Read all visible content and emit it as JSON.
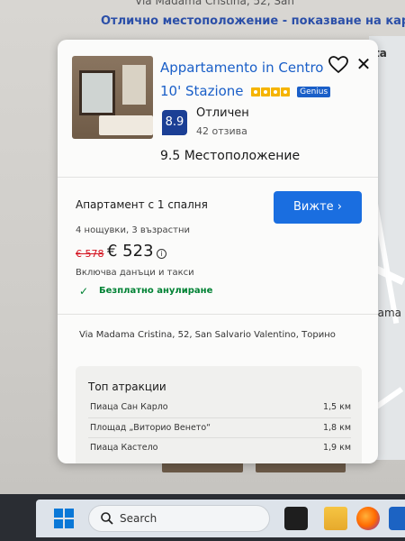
{
  "background": {
    "address_snippet": "Via Madama Cristina, 52, San",
    "map_link": "Отлично местоположение - показване на карта",
    "map_label": "dama",
    "map_badge": "ta"
  },
  "card": {
    "title_line1": "Appartamento in Centro",
    "title_line2": "10' Stazione",
    "stars": 4,
    "genius_badge": "Genius",
    "rating": {
      "score": "8.9",
      "label": "Отличен",
      "reviews": "42 отзива"
    },
    "location_score": "9.5 Местоположение",
    "room": {
      "name": "Апартамент с 1 спалня",
      "see_button": "Вижте",
      "nights": "4 нощувки, 3 възрастни",
      "price_old": "€ 578",
      "price_new": "€ 523",
      "taxes": "Включва данъци и такси",
      "free_cancel": "Безплатно анулиране"
    },
    "address": "Via Madama Cristina, 52, San Salvario Valentino, Торино",
    "attractions": {
      "title": "Топ атракции",
      "items": [
        {
          "name": "Пиаца Сан Карло",
          "distance": "1,5 км"
        },
        {
          "name": "Площад „Виторио Венето“",
          "distance": "1,8 км"
        },
        {
          "name": "Пиаца Кастело",
          "distance": "1,9 км"
        }
      ]
    }
  },
  "taskbar": {
    "search_placeholder": "Search"
  },
  "colors": {
    "brand_blue": "#1a5fc8",
    "button_blue": "#1a6ee0",
    "score_navy": "#1b3f95",
    "green": "#008234",
    "old_price_red": "#d4111e"
  }
}
